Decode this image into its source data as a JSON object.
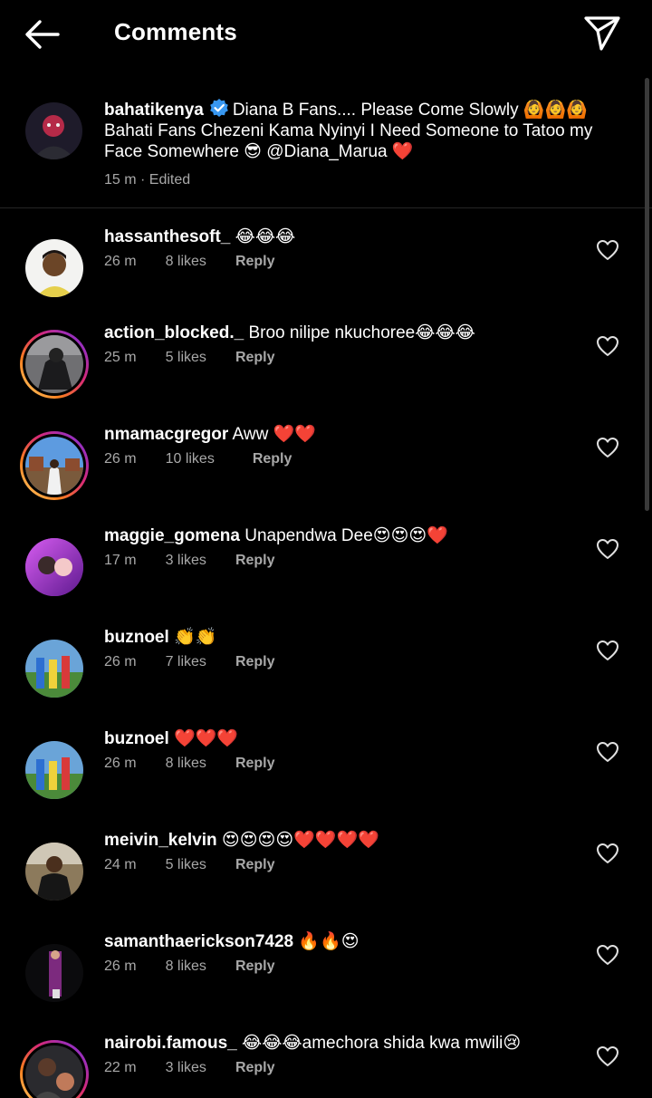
{
  "header": {
    "title": "Comments"
  },
  "caption": {
    "username": "bahatikenya",
    "text": "Diana B Fans.... Please Come Slowly 🙆🙆🙆 Bahati Fans Chezeni Kama Nyinyi I Need Someone to Tatoo my Face Somewhere 😎 @Diana_Marua ❤️",
    "meta": "15 m · Edited"
  },
  "comments": [
    {
      "username": "hassanthesoft_",
      "text": "😂😂😂",
      "time": "26 m",
      "likes": "8 likes",
      "reply": "Reply"
    },
    {
      "username": "action_blocked._",
      "text": "Broo nilipe nkuchoree😂😂😂",
      "time": "25 m",
      "likes": "5 likes",
      "reply": "Reply"
    },
    {
      "username": "nmamacgregor",
      "text": "Aww ❤️❤️",
      "time": "26 m",
      "likes": "10 likes",
      "reply": "Reply"
    },
    {
      "username": "maggie_gomena",
      "text": "Unapendwa Dee😍😍😍❤️",
      "time": "17 m",
      "likes": "3 likes",
      "reply": "Reply"
    },
    {
      "username": "buznoel",
      "text": "👏👏",
      "time": "26 m",
      "likes": "7 likes",
      "reply": "Reply"
    },
    {
      "username": "buznoel",
      "text": "❤️❤️❤️",
      "time": "26 m",
      "likes": "8 likes",
      "reply": "Reply"
    },
    {
      "username": "meivin_kelvin",
      "text": "😍😍😍😍❤️❤️❤️❤️",
      "time": "24 m",
      "likes": "5 likes",
      "reply": "Reply"
    },
    {
      "username": "samanthaerickson7428",
      "text": "🔥🔥😍",
      "time": "26 m",
      "likes": "8 likes",
      "reply": "Reply"
    },
    {
      "username": "nairobi.famous_",
      "text": "😂😂😂amechora shida kwa mwili😢",
      "time": "22 m",
      "likes": "3 likes",
      "reply": "Reply"
    }
  ],
  "icons": {
    "back": "back-arrow-icon",
    "share": "paper-plane-icon",
    "verified": "verified-badge-icon",
    "like": "heart-outline-icon"
  },
  "colors": {
    "background": "#000000",
    "text": "#ffffff",
    "secondary_text": "#a8a8a8",
    "verified": "#3897f0",
    "story_ring_start": "#feda75",
    "story_ring_end": "#962fbf"
  }
}
